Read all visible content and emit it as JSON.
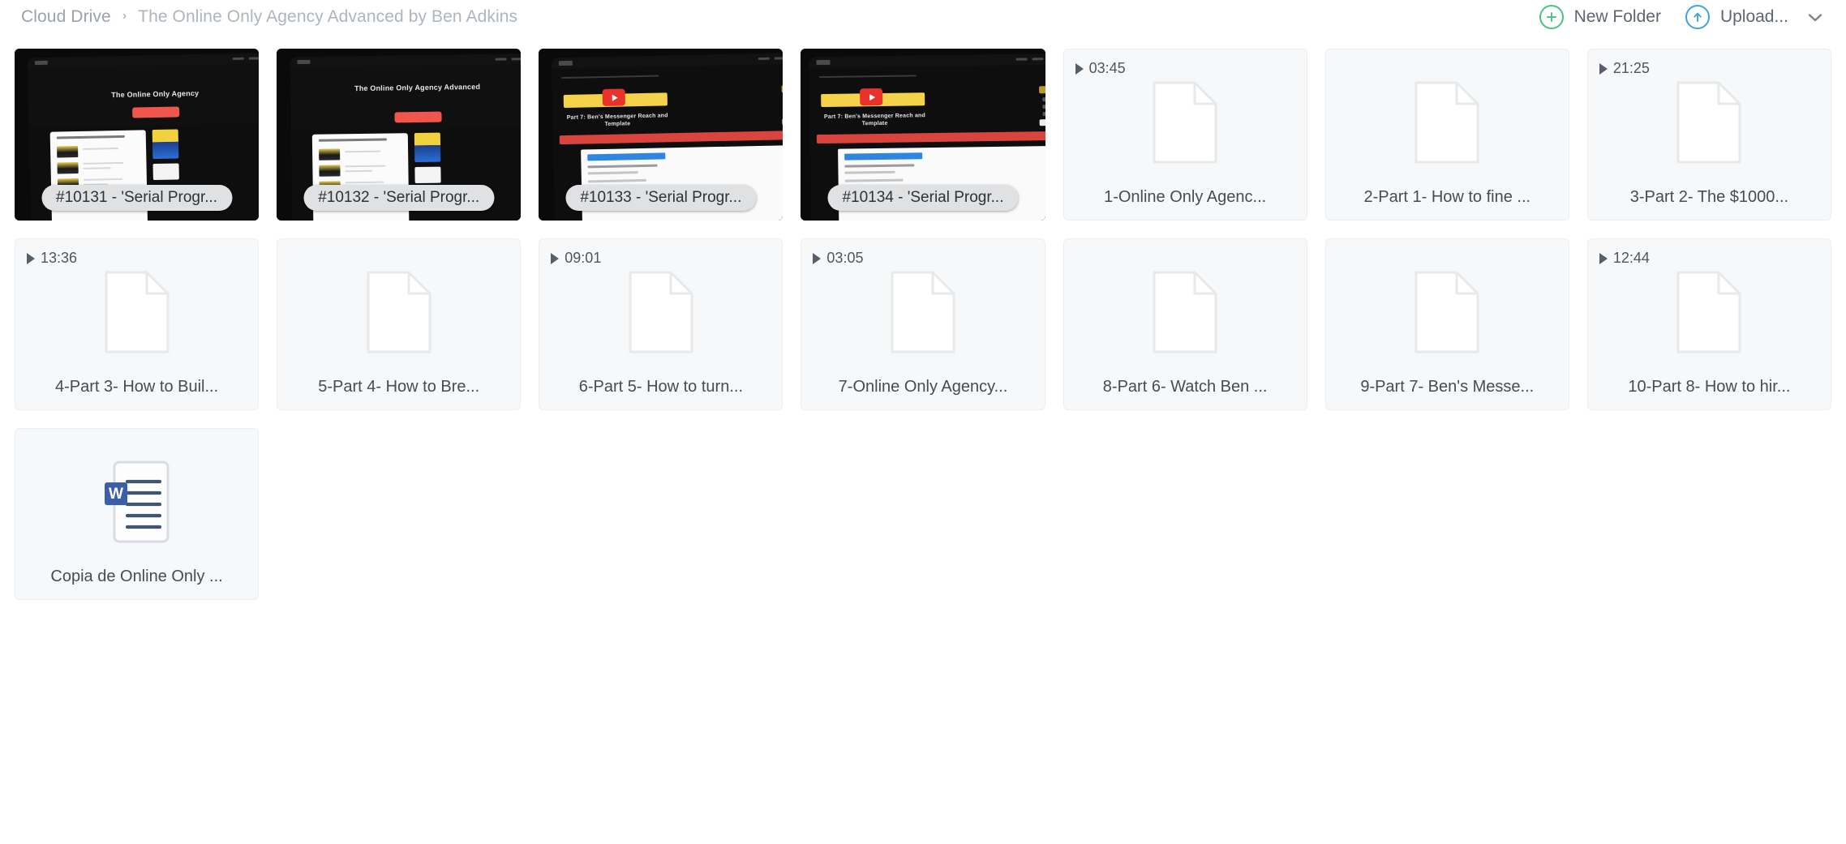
{
  "breadcrumb": {
    "root": "Cloud Drive",
    "separator": "›",
    "current": "The Online Only Agency Advanced by Ben Adkins"
  },
  "toolbar": {
    "new_folder_label": "New Folder",
    "new_folder_icon": "plus-circle-icon",
    "new_folder_color": "#4cc08a",
    "upload_label": "Upload...",
    "upload_icon": "upload-circle-icon",
    "upload_color": "#3fa3e0",
    "dropdown_icon": "chevron-down-icon"
  },
  "files": [
    {
      "name": "#10131 - 'Serial Progr...",
      "kind": "screenshot",
      "art": "hero",
      "duration": null,
      "hero_title": "The Online Only Agency"
    },
    {
      "name": "#10132 - 'Serial Progr...",
      "kind": "screenshot",
      "art": "hero2",
      "duration": null,
      "hero_title": "The Online Only Agency Advanced"
    },
    {
      "name": "#10133 - 'Serial Progr...",
      "kind": "screenshot",
      "art": "video",
      "duration": null,
      "hero_title": "Part 7: Ben's Messenger Reach and Template"
    },
    {
      "name": "#10134 - 'Serial Progr...",
      "kind": "screenshot",
      "art": "video2",
      "duration": null,
      "hero_title": "Part 7: Ben's Messenger Reach and Template"
    },
    {
      "name": "1-Online Only Agenc...",
      "kind": "document",
      "duration": "03:45"
    },
    {
      "name": "2-Part 1- How to fine ...",
      "kind": "document",
      "duration": null
    },
    {
      "name": "3-Part 2- The $1000...",
      "kind": "document",
      "duration": "21:25"
    },
    {
      "name": "4-Part 3- How to Buil...",
      "kind": "document",
      "duration": "13:36"
    },
    {
      "name": "5-Part 4- How to Bre...",
      "kind": "document",
      "duration": null
    },
    {
      "name": "6-Part 5- How to turn...",
      "kind": "document",
      "duration": "09:01"
    },
    {
      "name": "7-Online Only Agency...",
      "kind": "document",
      "duration": "03:05"
    },
    {
      "name": "8-Part 6- Watch Ben ...",
      "kind": "document",
      "duration": null
    },
    {
      "name": "9-Part 7- Ben's Messe...",
      "kind": "document",
      "duration": null
    },
    {
      "name": "10-Part 8- How to hir...",
      "kind": "document",
      "duration": "12:44"
    },
    {
      "name": "Copia de Online Only ...",
      "kind": "word",
      "duration": null,
      "badge": "W"
    }
  ]
}
